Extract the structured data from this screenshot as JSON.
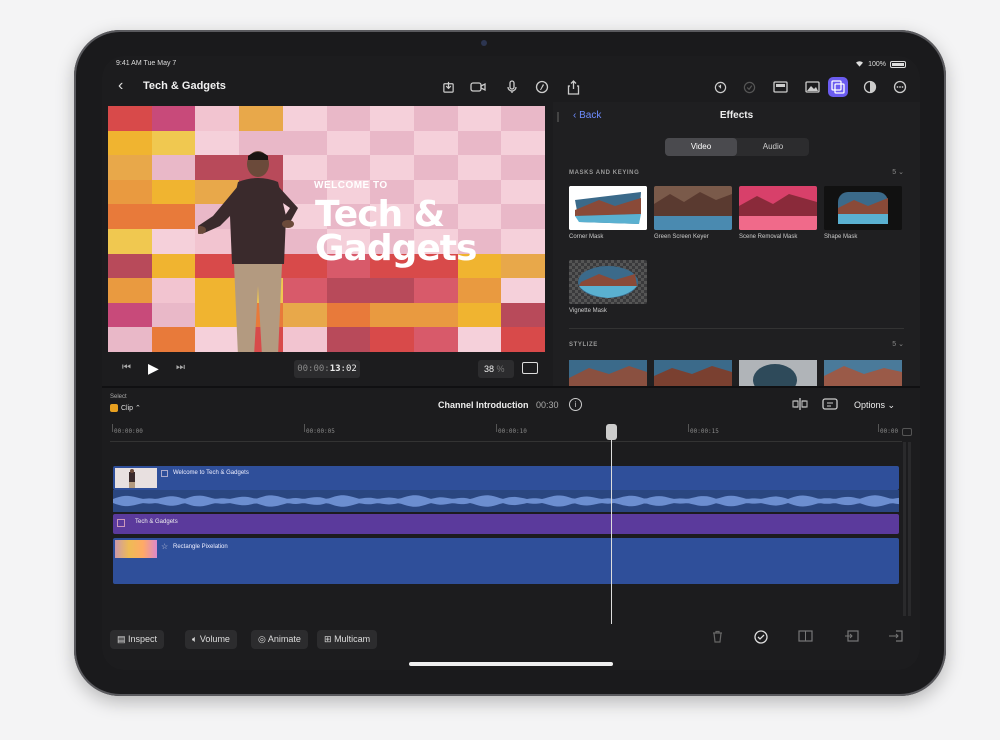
{
  "status": {
    "time": "9:41 AM",
    "date": "Tue May 7",
    "battery": "100%"
  },
  "topbar": {
    "title": "Tech & Gadgets",
    "icons": [
      "download-icon",
      "camera-icon",
      "microphone-icon",
      "pencil-circle-icon",
      "share-icon",
      "undo-icon",
      "check-icon",
      "viewer-layout-icon",
      "photo-icon",
      "effects-icon",
      "color-icon",
      "more-icon"
    ]
  },
  "viewer": {
    "overlay_small": "WELCOME TO",
    "overlay_title_1": "Tech &",
    "overlay_title_2": "Gadgets",
    "timecode_prefix": "00:00:",
    "timecode_main": "13",
    "timecode_frames": ":02",
    "zoom": "38",
    "zoom_unit": "%"
  },
  "effects_panel": {
    "back_label": "Back",
    "title": "Effects",
    "tabs": [
      {
        "label": "Video",
        "selected": true
      },
      {
        "label": "Audio",
        "selected": false
      }
    ],
    "sections": [
      {
        "name": "MASKS AND KEYING",
        "count": "5",
        "items": [
          "Corner Mask",
          "Green Screen Keyer",
          "Scene Removal Mask",
          "Shape Mask",
          "Vignette Mask"
        ]
      },
      {
        "name": "STYLIZE",
        "count": "5",
        "items": []
      }
    ]
  },
  "timeline": {
    "select_label": "Select",
    "clip_label": "Clip",
    "project_name": "Channel Introduction",
    "duration": "00:30",
    "options_label": "Options",
    "ruler_ticks": [
      "00:00:00",
      "00:00:05",
      "00:00:10",
      "00:00:15",
      "00:00"
    ],
    "clips": [
      {
        "label": "Welcome to Tech & Gadgets",
        "color": "#2f4f9a"
      },
      {
        "label": "Tech & Gadgets",
        "color": "#5b3a9c"
      },
      {
        "label": "Rectangle Pixelation",
        "color": "#2f4f9a"
      }
    ]
  },
  "bottombar": {
    "buttons": [
      "Inspect",
      "Volume",
      "Animate",
      "Multicam"
    ]
  },
  "colors": {
    "accent": "#6b5cf0",
    "link": "#6e8cff",
    "clip_blue": "#2f4f9a",
    "clip_purple": "#5b3a9c"
  }
}
